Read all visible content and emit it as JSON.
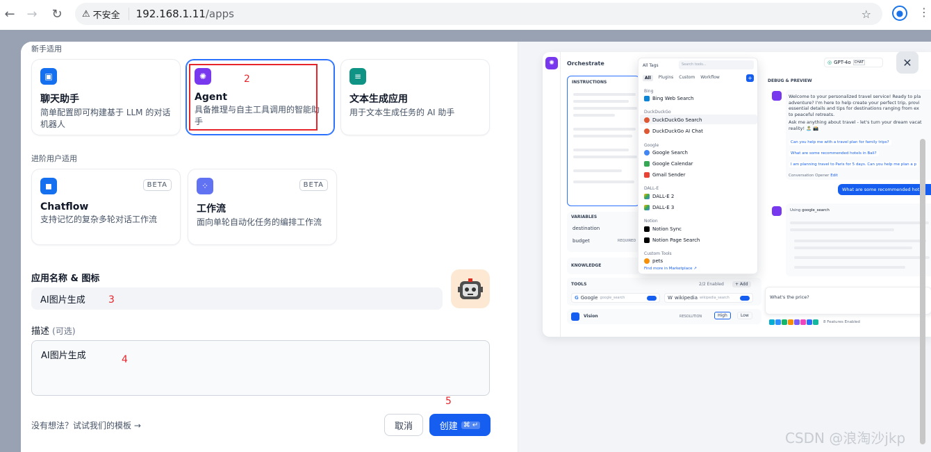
{
  "browser": {
    "security": "不安全",
    "url_host": "192.168.1.11",
    "url_path": "/apps"
  },
  "beginner": {
    "label": "新手适用",
    "cards": [
      {
        "title": "聊天助手",
        "desc": "简单配置即可构建基于 LLM 的对话机器人",
        "color": "#1570ef"
      },
      {
        "title": "Agent",
        "desc": "具备推理与自主工具调用的智能助手",
        "color": "#7839ee"
      },
      {
        "title": "文本生成应用",
        "desc": "用于文本生成任务的 AI 助手",
        "color": "#0e9384"
      }
    ]
  },
  "advanced": {
    "label": "进阶用户适用",
    "cards": [
      {
        "title": "Chatflow",
        "desc": "支持记忆的复杂多轮对话工作流",
        "badge": "BETA",
        "color": "#1570ef"
      },
      {
        "title": "工作流",
        "desc": "面向单轮自动化任务的编排工作流",
        "badge": "BETA",
        "color": "#6172f3"
      }
    ]
  },
  "form": {
    "name_label": "应用名称 & 图标",
    "name_value": "AI图片生成",
    "desc_label": "描述",
    "desc_optional": "(可选)",
    "desc_value": "AI图片生成"
  },
  "footer": {
    "template_link": "没有想法？试试我们的模板 →",
    "cancel": "取消",
    "create": "创建",
    "shortcut": "⌘ ↵"
  },
  "annotations": [
    "2",
    "3",
    "4",
    "5"
  ],
  "preview": {
    "header": "Orchestrate",
    "model": "GPT-4o",
    "model_tag": "CHAT",
    "instructions": "INSTRUCTIONS",
    "variables": "VARIABLES",
    "var1": "destination",
    "var2": "budget",
    "required": "REQUIRED",
    "knowledge": "KNOWLEDGE",
    "tools": "TOOLS",
    "tools_enabled": "2/2 Enabled",
    "add": "+ Add",
    "tool1": "Google",
    "tool1_id": "google_search",
    "tool2": "wikipedia",
    "tool2_id": "wikipedia_search",
    "vision": "Vision",
    "resolution": "RESOLUTION",
    "high": "High",
    "low": "Low",
    "dropdown": {
      "all_tags": "All Tags",
      "search": "Search tools...",
      "tabs": [
        "All",
        "Plugins",
        "Custom",
        "Workflow"
      ],
      "groups": [
        {
          "name": "Bing",
          "items": [
            "Bing Web Search"
          ]
        },
        {
          "name": "DuckDuckGo",
          "items": [
            "DuckDuckGo Search",
            "DuckDuckGo AI Chat"
          ]
        },
        {
          "name": "Google",
          "items": [
            "Google Search",
            "Google Calendar",
            "Gmail Sender"
          ]
        },
        {
          "name": "DALL-E",
          "items": [
            "DALL-E 2",
            "DALL-E 3"
          ]
        },
        {
          "name": "Notion",
          "items": [
            "Notion Sync",
            "Notion Page Search"
          ]
        },
        {
          "name": "Custom Tools",
          "items": [
            "pets"
          ]
        }
      ],
      "marketplace": "Find more in Marketplace ↗"
    },
    "debug": "DEBUG & PREVIEW",
    "welcome1": "Welcome to your personalized travel service! Ready to pla",
    "welcome2": "adventure? I'm here to help create your perfect trip, provi",
    "welcome3": "essential details and tips for destinations ranging from ex",
    "welcome4": "to peaceful retreats.",
    "ask1": "Ask me anything about travel - let's turn your dream vacat",
    "ask2": "reality! 🏝️ 📸",
    "q1": "Can you help me with a travel plan for family trips?",
    "q2": "What are some recommended hotels in Bali?",
    "q3": "I am planning travel to Paris for 5 days. Can you help me plan a p",
    "opener": "Conversation Opener",
    "edit": "Edit",
    "user_msg": "What are some recommended hot",
    "using": "Using",
    "using_tool": "google_search",
    "input": "What's the price?",
    "features": "8 Features Enabled"
  },
  "watermark": "CSDN @浪淘沙jkp"
}
